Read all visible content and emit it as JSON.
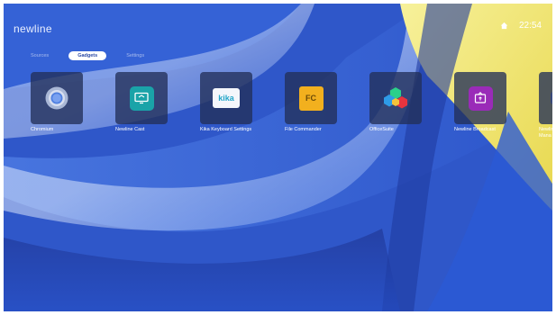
{
  "header": {
    "logo": "newline",
    "time": "22:54",
    "status_icon": "home-icon"
  },
  "tabs": [
    {
      "label": "Sources",
      "active": false
    },
    {
      "label": "Gadgets",
      "active": true
    },
    {
      "label": "Settings",
      "active": false
    }
  ],
  "apps": [
    {
      "label": "Chromium",
      "icon": "chromium-icon"
    },
    {
      "label": "Newline Cast",
      "icon": "cast-icon"
    },
    {
      "label": "Kika Keyboard Settings",
      "icon": "kika-icon",
      "icon_text": "kika"
    },
    {
      "label": "File Commander",
      "icon": "file-commander-icon",
      "icon_text": "FC"
    },
    {
      "label": "OfficeSuite",
      "icon": "officesuite-icon"
    },
    {
      "label": "Newline Broadcast",
      "icon": "broadcast-icon"
    },
    {
      "label": "Newline Mana",
      "icon": "manager-icon"
    }
  ],
  "colors": {
    "background": "#2f56c7",
    "tile": "#233058",
    "cast": "#1aa3a8",
    "file_commander": "#f2b01e",
    "broadcast": "#9a2bb8"
  }
}
